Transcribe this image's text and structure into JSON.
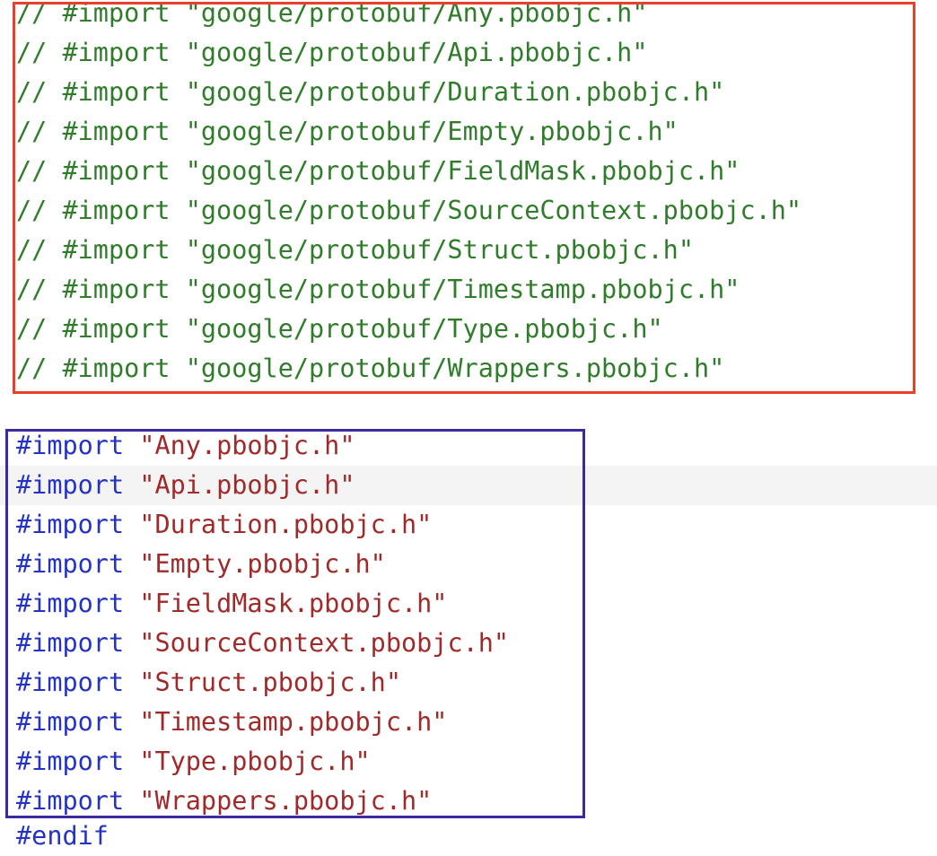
{
  "comment_lines": [
    "// #import \"google/protobuf/Any.pbobjc.h\"",
    "// #import \"google/protobuf/Api.pbobjc.h\"",
    "// #import \"google/protobuf/Duration.pbobjc.h\"",
    "// #import \"google/protobuf/Empty.pbobjc.h\"",
    "// #import \"google/protobuf/FieldMask.pbobjc.h\"",
    "// #import \"google/protobuf/SourceContext.pbobjc.h\"",
    "// #import \"google/protobuf/Struct.pbobjc.h\"",
    "// #import \"google/protobuf/Timestamp.pbobjc.h\"",
    "// #import \"google/protobuf/Type.pbobjc.h\"",
    "// #import \"google/protobuf/Wrappers.pbobjc.h\""
  ],
  "import_keyword": "#import",
  "import_lines": [
    "\"Any.pbobjc.h\"",
    "\"Api.pbobjc.h\"",
    "\"Duration.pbobjc.h\"",
    "\"Empty.pbobjc.h\"",
    "\"FieldMask.pbobjc.h\"",
    "\"SourceContext.pbobjc.h\"",
    "\"Struct.pbobjc.h\"",
    "\"Timestamp.pbobjc.h\"",
    "\"Type.pbobjc.h\"",
    "\"Wrappers.pbobjc.h\""
  ],
  "partial_line": "#endif",
  "colors": {
    "comment": "#2f7d2a",
    "directive": "#2432c6",
    "string": "#a02a2a",
    "red_box": "#e8402a",
    "purple_box": "#3d2aa0",
    "current_line_highlight": "#f4f4f4"
  }
}
